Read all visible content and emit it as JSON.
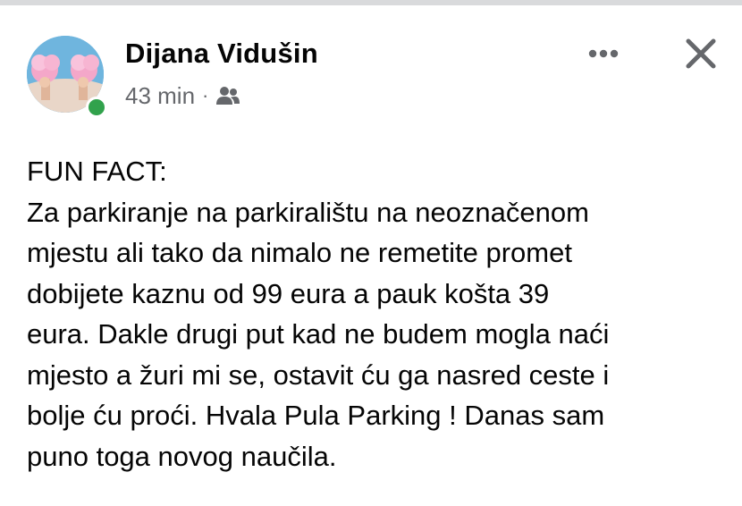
{
  "post": {
    "author_name": "Dijana Vidušin",
    "timestamp": "43 min",
    "meta_separator": "·",
    "audience_icon": "friends-icon",
    "more_icon": "more-horizontal-icon",
    "close_icon": "close-icon",
    "online_status": "online",
    "body_lines": [
      "FUN FACT:",
      "Za parkiranje na parkiralištu na neoznačenom",
      "mjestu ali tako da nimalo ne remetite promet",
      "dobijete kaznu od 99 eura a pauk košta 39",
      "eura. Dakle drugi put kad ne budem mogla naći",
      "mjesto a žuri mi se, ostavit ću ga nasred ceste i",
      "bolje ću proći. Hvala Pula Parking ! Danas sam",
      "puno toga novog naučila."
    ]
  },
  "colors": {
    "text_primary": "#050505",
    "text_secondary": "#65676b",
    "online_green": "#31a24c",
    "top_strip": "#d9dadc"
  }
}
